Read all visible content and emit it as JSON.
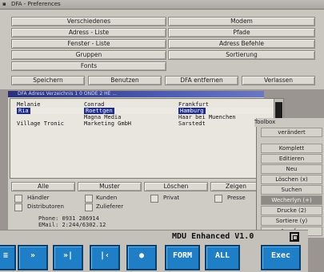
{
  "prefs": {
    "title": "DFA - Preferences",
    "left_buttons": [
      "Verschiedenes",
      "Adress - Liste",
      "Fenster - Liste",
      "Gruppen",
      "Fonts"
    ],
    "right_buttons": [
      "Modem",
      "Pfade",
      "Adress Befehle",
      "Sortierung"
    ],
    "bottom_buttons": [
      "Speichern",
      "Benutzen",
      "DFA entfernen",
      "Verlassen"
    ]
  },
  "address": {
    "title": "DFA Adress  Verzeichnis  1  0 ONDE  2 HE  ...",
    "columns": [
      "Melanie",
      "Conrad",
      "Frankfurt"
    ],
    "rows": [
      {
        "c1": "Melanie",
        "c2": "Conrad",
        "c3": "Frankfurt",
        "selected": false
      },
      {
        "c1": "Ria",
        "c2": "Roettgen",
        "c3": "Hamburg",
        "selected": true
      },
      {
        "c1": "",
        "c2": "Magna Media",
        "c3": "Haar bei Muenchen",
        "selected": false
      },
      {
        "c1": "Village Tronic",
        "c2": "Marketing GmbH",
        "c3": "Sarstedt",
        "selected": false
      }
    ],
    "action_buttons": [
      "Alle",
      "Muster",
      "Löschen",
      "Zeigen"
    ],
    "checkboxes": [
      {
        "label": "Händler"
      },
      {
        "label": "Kunden"
      },
      {
        "label": "Privat"
      },
      {
        "label": "Presse"
      },
      {
        "label": "Distributoren"
      },
      {
        "label": "Zulieferer"
      }
    ],
    "phone": "Phone: 0931 286914",
    "email": "EMail: 2:244/6302.12"
  },
  "toolbox": {
    "title": "Toolbox",
    "items": [
      {
        "label": "verändert",
        "highlighted": false
      },
      {
        "label": "Komplett",
        "highlighted": false
      },
      {
        "label": "Editieren",
        "highlighted": false
      },
      {
        "label": "Neu",
        "highlighted": false
      },
      {
        "label": "Löschen (x)",
        "highlighted": false
      },
      {
        "label": "Suchen",
        "highlighted": false
      },
      {
        "label": "Wecherlyn (+)",
        "highlighted": true
      },
      {
        "label": "Drucke (2)",
        "highlighted": false
      },
      {
        "label": "Sortiere (y)",
        "highlighted": false
      },
      {
        "label": "Anrufen",
        "highlighted": false
      }
    ]
  },
  "control_bar": {
    "title": "MDU Enhanced V1.0",
    "buttons": [
      "≡",
      "»",
      "»|",
      "|‹",
      "●",
      "FORM",
      "ALL",
      "Exec"
    ]
  },
  "colors": {
    "accent_blue": "#1e7fc6",
    "title_blue": "#28307a",
    "selection": "#1d2c8e"
  }
}
